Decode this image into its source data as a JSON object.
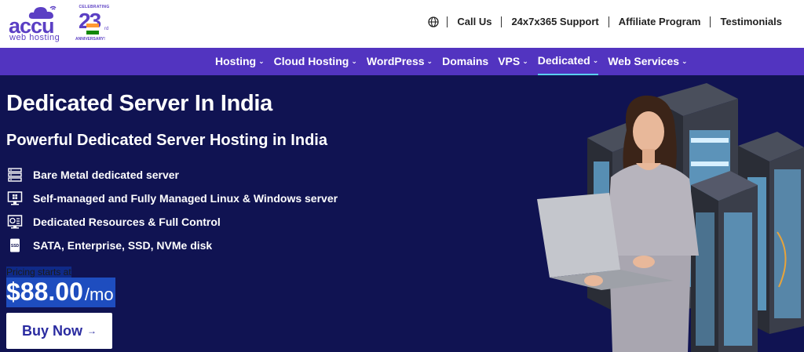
{
  "brand": {
    "name": "accu",
    "tagline": "web hosting",
    "badge_top": "CELEBRATING",
    "badge_number": "23",
    "badge_suffix": "rd",
    "badge_bottom": "ANNIVERSARY!",
    "color": "#5b3fc4"
  },
  "toplinks": [
    "Call Us",
    "24x7x365 Support",
    "Affiliate Program",
    "Testimonials"
  ],
  "nav": [
    {
      "label": "Hosting",
      "chevron": "⌄"
    },
    {
      "label": "Cloud Hosting",
      "chevron": "⌄"
    },
    {
      "label": "WordPress",
      "chevron": "⌄"
    },
    {
      "label": "Domains",
      "chevron": ""
    },
    {
      "label": "VPS",
      "chevron": "⌄"
    },
    {
      "label": "Dedicated",
      "chevron": "⌄"
    },
    {
      "label": "Web Services",
      "chevron": "⌄"
    }
  ],
  "hero": {
    "title": "Dedicated Server In India",
    "subtitle": "Powerful Dedicated Server Hosting in India",
    "features": [
      {
        "icon": "server-rack-icon",
        "text": "Bare Metal dedicated server"
      },
      {
        "icon": "monitor-windows-icon",
        "text": "Self-managed and Fully Managed Linux & Windows server"
      },
      {
        "icon": "dashboard-control-icon",
        "text": "Dedicated Resources & Full Control"
      },
      {
        "icon": "ssd-disk-icon",
        "text": "SATA, Enterprise, SSD, NVMe disk"
      }
    ],
    "pricing_label": "Pricing starts at",
    "price": "$88.00",
    "per": "/mo",
    "buy_label": "Buy Now",
    "buy_arrow": "→"
  },
  "colors": {
    "nav_bg": "#5234c0",
    "hero_bg": "#101352",
    "active_underline": "#5ad0f0"
  }
}
